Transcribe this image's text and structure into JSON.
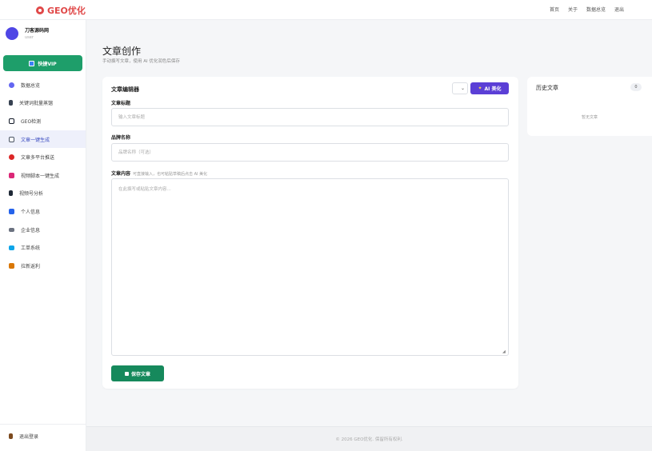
{
  "brand": {
    "name": "GEO优化",
    "color": "#e04848"
  },
  "topnav": {
    "items": [
      "首页",
      "关于",
      "数据总览",
      "退出"
    ]
  },
  "user": {
    "name": "刀客源码网",
    "role": "user"
  },
  "sidebar": {
    "vip_label": "快捷VIP",
    "items": [
      {
        "label": "数据总览",
        "icon": "shield-icon",
        "color": "#6366f1"
      },
      {
        "label": "关键词批量蒸馏",
        "icon": "megaphone-icon",
        "color": "#374151"
      },
      {
        "label": "GEO检测",
        "icon": "monitor-icon",
        "color": "#111827"
      },
      {
        "label": "文章一键生成",
        "icon": "document-icon",
        "color": "#4b5563",
        "active": true
      },
      {
        "label": "文章多平台推送",
        "icon": "platform-icon",
        "color": "#dc2626"
      },
      {
        "label": "视频脚本一键生成",
        "icon": "video-icon",
        "color": "#db2777"
      },
      {
        "label": "视频号分析",
        "icon": "chart-icon",
        "color": "#1f2937"
      },
      {
        "label": "个人信息",
        "icon": "id-card-icon",
        "color": "#2563eb"
      },
      {
        "label": "企业信息",
        "icon": "car-icon",
        "color": "#6b7280"
      },
      {
        "label": "工单系统",
        "icon": "ticket-icon",
        "color": "#0ea5e9"
      },
      {
        "label": "拉新返利",
        "icon": "gift-icon",
        "color": "#d97706"
      }
    ],
    "logout_label": "退出登录"
  },
  "page": {
    "title": "文章创作",
    "subtitle": "手动撰写文章，使用 AI 优化润色后保存"
  },
  "editor": {
    "title": "文章编辑器",
    "select_value": "",
    "ai_button": "AI 美化",
    "fields": {
      "title_label": "文章标题",
      "title_placeholder": "输入文章标题",
      "brand_label": "品牌名称",
      "brand_placeholder": "品牌名称（可选）",
      "content_label": "文章内容",
      "content_hint": "可直接输入，也可粘贴草稿后点击 AI 美化",
      "content_placeholder": "在此撰写或粘贴文章内容..."
    },
    "save_button": "保存文章"
  },
  "history": {
    "title": "历史文章",
    "count": "0",
    "empty_text": "暂无文章"
  },
  "footer": {
    "text": "© 2026 GEO优化. 保留所有权利."
  },
  "colors": {
    "accent": "#1e9e6a",
    "ai_button": "#5b3fd6",
    "active_menu_bg": "#eef0fb"
  }
}
